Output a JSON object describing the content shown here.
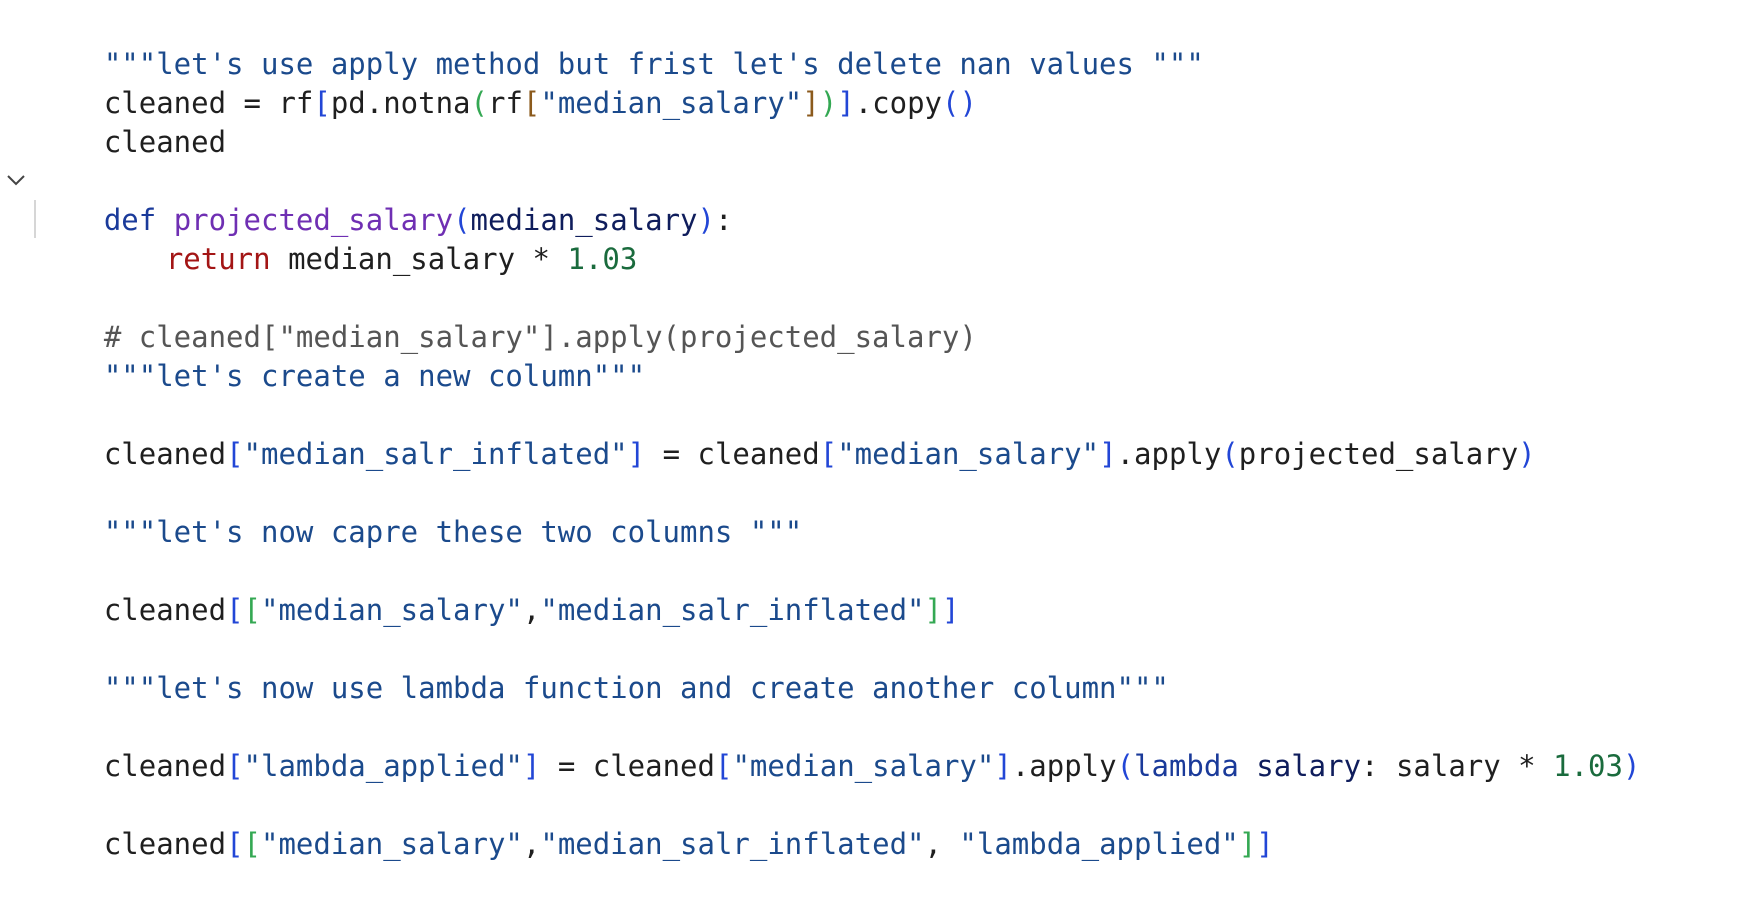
{
  "code_lines": {
    "l1": {
      "text": "\"\"\"let's use apply method but frist let's delete nan values \"\"\""
    },
    "l2": {
      "a": "cleaned = rf",
      "b": "[",
      "c": "pd.notna",
      "d": "(",
      "e": "rf",
      "f": "[",
      "g": "\"median_salary\"",
      "h": "]",
      "i": ")",
      "j": "]",
      "k": ".copy",
      "l": "()"
    },
    "l3": {
      "text": "cleaned"
    },
    "l4": {
      "kw": "def",
      "fn": "projected_salary",
      "open": "(",
      "param": "median_salary",
      "close": ")",
      "colon": ":"
    },
    "l5": {
      "ret": "return",
      "expr": "median_salary * ",
      "num": "1.03"
    },
    "l6": {
      "text": "# cleaned[\"median_salary\"].apply(projected_salary)"
    },
    "l7": {
      "text": "\"\"\"let's create a new column\"\"\""
    },
    "l8": {
      "a": "cleaned",
      "b": "[",
      "c": "\"median_salr_inflated\"",
      "d": "]",
      "e": " = cleaned",
      "f": "[",
      "g": "\"median_salary\"",
      "h": "]",
      "i": ".apply",
      "j": "(",
      "k": "projected_salary",
      "l": ")"
    },
    "l9": {
      "text": "\"\"\"let's now capre these two columns \"\"\""
    },
    "l10": {
      "a": "cleaned",
      "b": "[",
      "c": "[",
      "d": "\"median_salary\"",
      "e": ",",
      "f": "\"median_salr_inflated\"",
      "g": "]",
      "h": "]"
    },
    "l11": {
      "text": "\"\"\"let's now use lambda function and create another column\"\"\""
    },
    "l12": {
      "a": "cleaned",
      "b": "[",
      "c": "\"lambda_applied\"",
      "d": "]",
      "e": " = cleaned",
      "f": "[",
      "g": "\"median_salary\"",
      "h": "]",
      "i": ".apply",
      "j": "(",
      "k": "lambda",
      "l": " ",
      "m": "salary",
      "n": ": salary * ",
      "o": "1.03",
      "p": ")"
    },
    "l13": {
      "a": "cleaned",
      "b": "[",
      "c": "[",
      "d": "\"median_salary\"",
      "e": ",",
      "f": "\"median_salr_inflated\"",
      "g": ", ",
      "h": "\"lambda_applied\"",
      "i": "]",
      "j": "]"
    }
  },
  "icons": {
    "fold": "chevron-down-icon"
  },
  "colors": {
    "docstring": "#1b4a8c",
    "keyword": "#1a3a9a",
    "function_name": "#6f2fb3",
    "parameter": "#0f1d5c",
    "number": "#1a6b3d",
    "return_keyword": "#a31515",
    "comment": "#555555",
    "bracket_level_1": "#2246d6",
    "bracket_level_2": "#34a853",
    "bracket_level_3": "#8b5a1c"
  }
}
